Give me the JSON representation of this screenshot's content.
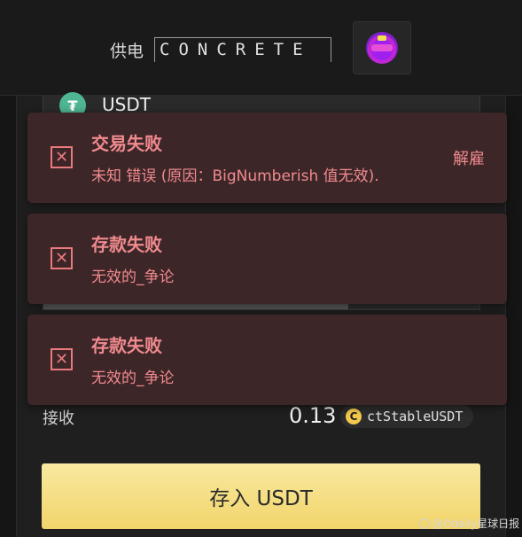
{
  "header": {
    "powered_by": "供电",
    "logo_text": "CONCRETE",
    "avatar": "avatar-icon"
  },
  "deposit": {
    "token": "USDT",
    "token_icon": "tether-icon",
    "progress_fraction": 0.7,
    "receive_label": "接收",
    "receive_amount": "0.13",
    "receive_token": "ctStableUSDT",
    "receive_token_icon": "C",
    "button_label": "存入 USDT"
  },
  "toasts": [
    {
      "title": "交易失败",
      "message": "未知 错误 (原因：BigNumberish 值无效).",
      "dismiss_label": "解雇",
      "icon": "close-box-icon",
      "color": "#f08a8e"
    },
    {
      "title": "存款失败",
      "message": "无效的_争论",
      "icon": "close-box-icon",
      "color": "#f08a8e"
    },
    {
      "title": "存款失败",
      "message": "无效的_争论",
      "icon": "close-box-icon",
      "color": "#f08a8e"
    }
  ],
  "watermark": {
    "text": "@Odaily星球日报"
  },
  "colors": {
    "background": "#151515",
    "toast_bg": "#3d2628",
    "accent": "#f2d46a"
  }
}
